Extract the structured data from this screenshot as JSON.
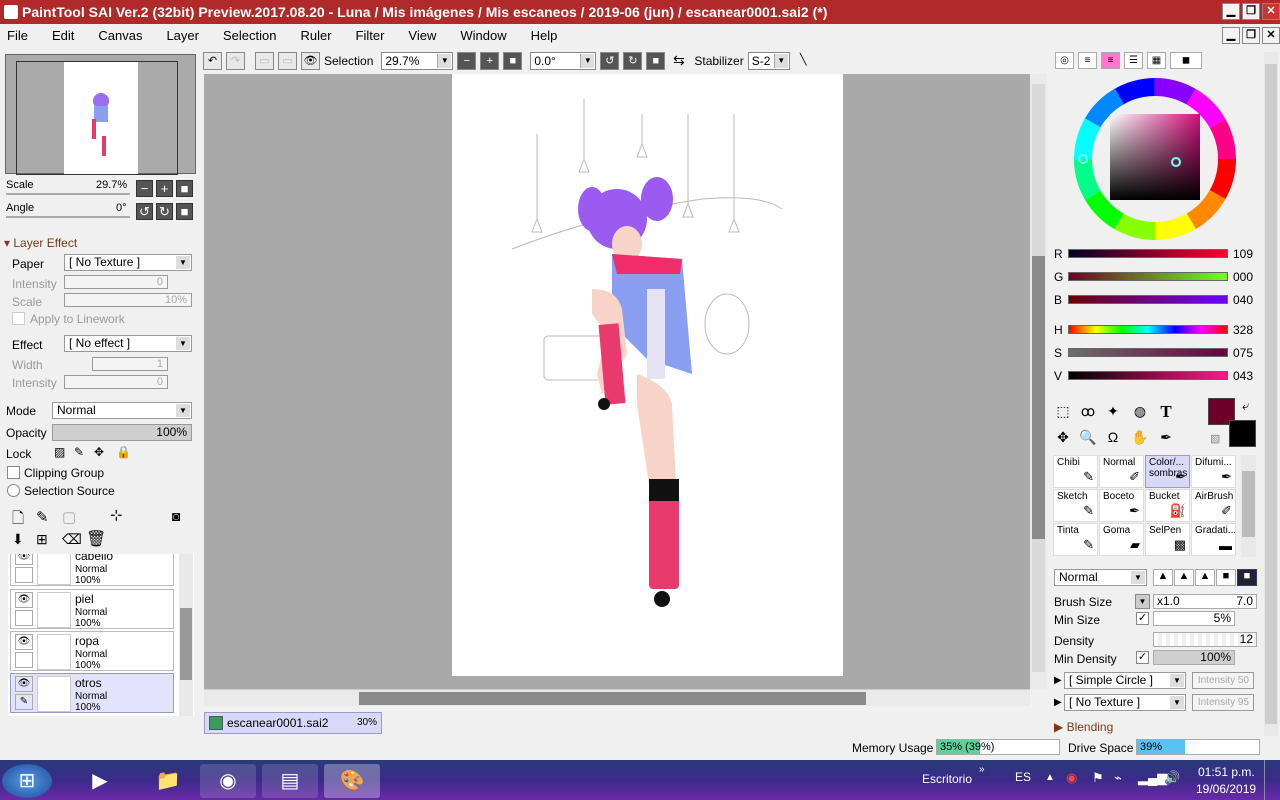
{
  "window": {
    "title": "PaintTool SAI Ver.2 (32bit) Preview.2017.08.20 - Luna / Mis imágenes / Mis escaneos / 2019-06 (jun) / escanear0001.sai2 (*)"
  },
  "menu": [
    "File",
    "Edit",
    "Canvas",
    "Layer",
    "Selection",
    "Ruler",
    "Filter",
    "View",
    "Window",
    "Help"
  ],
  "toolbar": {
    "selection_label": "Selection",
    "zoom": "29.7%",
    "angle": "0.0°",
    "stabilizer_label": "Stabilizer",
    "stabilizer_value": "S-2"
  },
  "navigator": {
    "scale_label": "Scale",
    "scale_value": "29.7%",
    "angle_label": "Angle",
    "angle_value": "0°"
  },
  "layer_effect": {
    "header": "Layer Effect",
    "paper_label": "Paper",
    "paper_value": "[ No Texture ]",
    "intensity_label": "Intensity",
    "intensity_value": "0",
    "scale_label": "Scale",
    "scale_value": "10%",
    "apply_label": "Apply to Linework",
    "effect_label": "Effect",
    "effect_value": "[ No effect ]",
    "width_label": "Width",
    "width_value": "1",
    "intensity2_label": "Intensity",
    "intensity2_value": "0"
  },
  "layer_props": {
    "mode_label": "Mode",
    "mode_value": "Normal",
    "opacity_label": "Opacity",
    "opacity_value": "100%",
    "lock_label": "Lock",
    "clipping_label": "Clipping Group",
    "selection_source_label": "Selection Source"
  },
  "layers": [
    {
      "name": "cabello",
      "mode": "Normal",
      "opacity": "100%",
      "selected": false
    },
    {
      "name": "piel",
      "mode": "Normal",
      "opacity": "100%",
      "selected": false
    },
    {
      "name": "ropa",
      "mode": "Normal",
      "opacity": "100%",
      "selected": false
    },
    {
      "name": "otros",
      "mode": "Normal",
      "opacity": "100%",
      "selected": true
    }
  ],
  "document_tab": {
    "name": "escanear0001.sai2",
    "zoom": "30%"
  },
  "color": {
    "r_label": "R",
    "r": "109",
    "g_label": "G",
    "g": "000",
    "b_label": "B",
    "b": "040",
    "h_label": "H",
    "h": "328",
    "s_label": "S",
    "s": "075",
    "v_label": "V",
    "v": "043",
    "primary": "#6d0028",
    "secondary": "#000000"
  },
  "brushes": [
    {
      "name": "Chibi",
      "selected": false
    },
    {
      "name": "Normal",
      "selected": false
    },
    {
      "name": "Color/... sombras",
      "selected": true
    },
    {
      "name": "Difumi...",
      "selected": false
    },
    {
      "name": "Sketch",
      "selected": false
    },
    {
      "name": "Boceto",
      "selected": false
    },
    {
      "name": "Bucket",
      "selected": false
    },
    {
      "name": "AirBrush",
      "selected": false
    },
    {
      "name": "Tinta",
      "selected": false
    },
    {
      "name": "Goma",
      "selected": false
    },
    {
      "name": "SelPen",
      "selected": false
    },
    {
      "name": "Gradati...",
      "selected": false
    }
  ],
  "brush_settings": {
    "blend_mode": "Normal",
    "brush_size_label": "Brush Size",
    "brush_size_mult": "x1.0",
    "brush_size_value": "7.0",
    "min_size_label": "Min Size",
    "min_size_value": "5%",
    "density_label": "Density",
    "density_value": "12",
    "min_density_label": "Min Density",
    "min_density_value": "100%",
    "shape": "[ Simple Circle ]",
    "shape_intensity": "Intensity 50",
    "texture": "[ No Texture ]",
    "texture_intensity": "Intensity 95",
    "blending_label": "Blending"
  },
  "status": {
    "memory_label": "Memory Usage",
    "memory_value": "35% (39%)",
    "memory_fraction": 0.35,
    "drive_label": "Drive Space",
    "drive_value": "39%",
    "drive_fraction": 0.39
  },
  "taskbar": {
    "desktop_label": "Escritorio",
    "language": "ES",
    "time": "01:51 p.m.",
    "date": "19/06/2019"
  }
}
